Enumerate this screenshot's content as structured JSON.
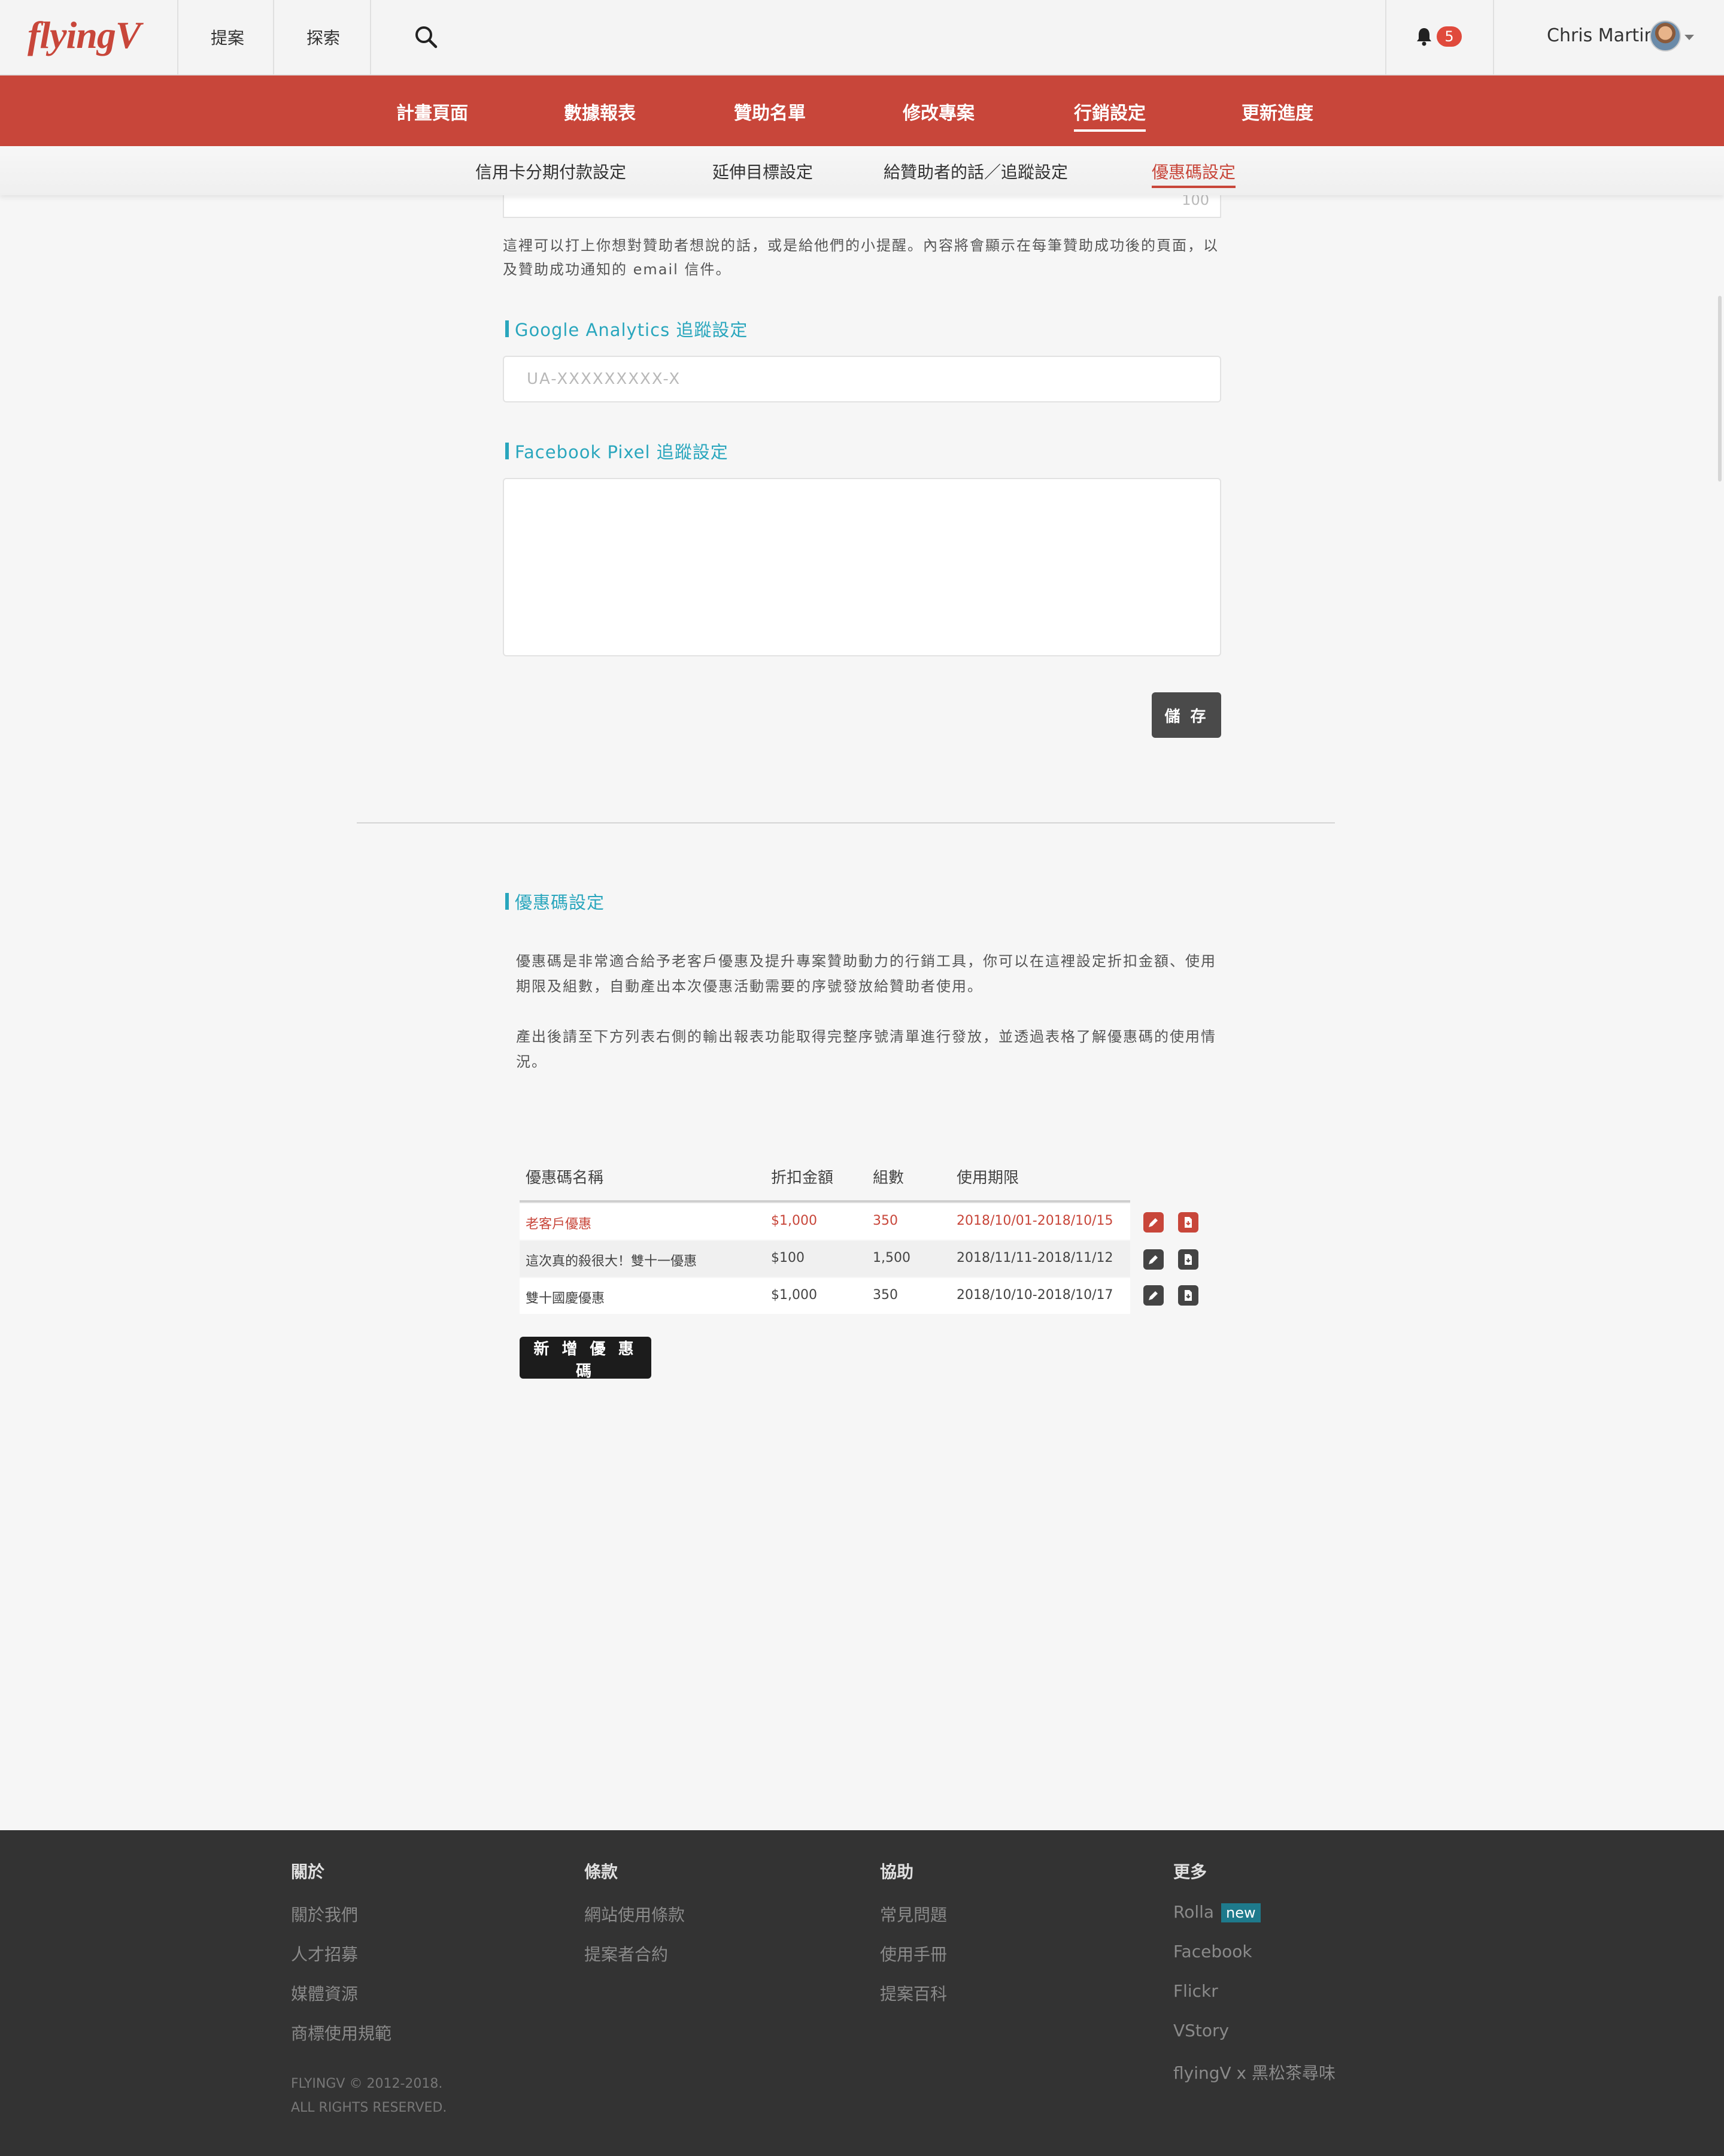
{
  "header": {
    "logo": "flyingV",
    "nav": [
      "提案",
      "探索"
    ],
    "notifications_count": "5",
    "user_name": "Chris Martin"
  },
  "main_nav": {
    "items": [
      "計畫頁面",
      "數據報表",
      "贊助名單",
      "修改專案",
      "行銷設定",
      "更新進度"
    ],
    "active": "行銷設定"
  },
  "sub_nav": {
    "items": [
      "信用卡分期付款設定",
      "延伸目標設定",
      "給贊助者的話／追蹤設定",
      "優惠碼設定"
    ],
    "active": "優惠碼設定"
  },
  "message_field": {
    "char_count": "100",
    "help_text": "這裡可以打上你想對贊助者想說的話，或是給他們的小提醒。內容將會顯示在每筆贊助成功後的頁面，以及贊助成功通知的 email 信件。"
  },
  "ga": {
    "label": "Google Analytics 追蹤設定",
    "placeholder": "UA-XXXXXXXXX-X"
  },
  "fb_pixel": {
    "label": "Facebook Pixel 追蹤設定"
  },
  "save_label": "儲 存",
  "coupon": {
    "title": "優惠碼設定",
    "desc1": "優惠碼是非常適合給予老客戶優惠及提升專案贊助動力的行銷工具，你可以在這裡設定折扣金額、使用期限及組數，自動產出本次優惠活動需要的序號發放給贊助者使用。",
    "desc2": "產出後請至下方列表右側的輸出報表功能取得完整序號清單進行發放，並透過表格了解優惠碼的使用情況。",
    "columns": [
      "優惠碼名稱",
      "折扣金額",
      "組數",
      "使用期限"
    ],
    "rows": [
      {
        "name": "老客戶優惠",
        "amount": "$1,000",
        "sets": "350",
        "period": "2018/10/01-2018/10/15"
      },
      {
        "name": "這次真的殺很大！雙十一優惠",
        "amount": "$100",
        "sets": "1,500",
        "period": "2018/11/11-2018/11/12"
      },
      {
        "name": "雙十國慶優惠",
        "amount": "$1,000",
        "sets": "350",
        "period": "2018/10/10-2018/10/17"
      }
    ],
    "add_label": "新 增 優 惠 碼"
  },
  "footer": {
    "columns": [
      {
        "heading": "關於",
        "links": [
          "關於我們",
          "人才招募",
          "媒體資源",
          "商標使用規範"
        ]
      },
      {
        "heading": "條款",
        "links": [
          "網站使用條款",
          "提案者合約"
        ]
      },
      {
        "heading": "協助",
        "links": [
          "常見問題",
          "使用手冊",
          "提案百科"
        ]
      },
      {
        "heading": "更多",
        "links": [
          "Rolla",
          "Facebook",
          "Flickr",
          "VStory",
          "flyingV x 黑松茶尋味"
        ]
      }
    ],
    "new_badge": "new",
    "copyright_1": "FLYINGV © 2012-2018.",
    "copyright_2": "ALL RIGHTS RESERVED."
  },
  "colors": {
    "brand_red": "#c8463a",
    "accent_teal": "#29a6bd",
    "footer_bg": "#333333"
  }
}
